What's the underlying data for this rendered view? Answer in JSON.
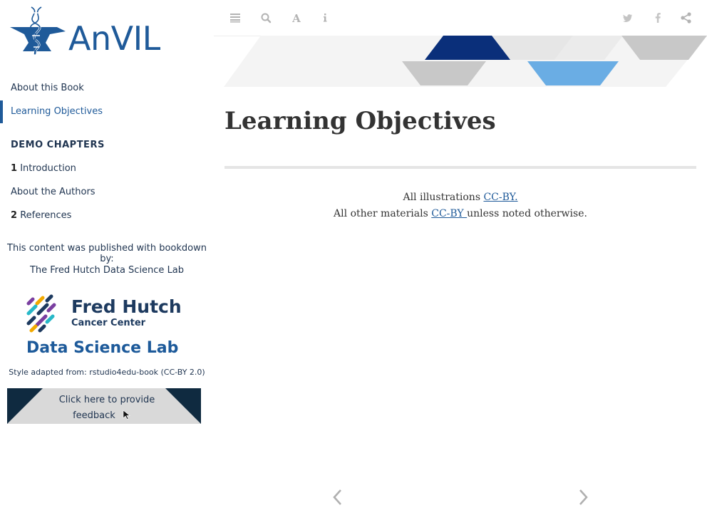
{
  "brand": {
    "name": "AnVIL"
  },
  "sidebar": {
    "items": [
      {
        "label": "About this Book",
        "number": ""
      },
      {
        "label": "Learning Objectives",
        "number": ""
      },
      {
        "label": "Introduction",
        "number": "1"
      },
      {
        "label": "About the Authors",
        "number": ""
      },
      {
        "label": "References",
        "number": "2"
      }
    ],
    "section_header": "DEMO CHAPTERS",
    "published_by": "This content was published with bookdown by:",
    "publisher": "The Fred Hutch Data Science Lab",
    "fred_hutch": {
      "name": "Fred Hutch",
      "sub": "Cancer Center",
      "lab": "Data Science Lab"
    },
    "style_note": "Style adapted from: rstudio4edu-book (CC-BY 2.0)",
    "feedback": {
      "line1": "Click here to provide",
      "line2": "feedback"
    }
  },
  "toolbar": {
    "icons": [
      "menu-icon",
      "search-icon",
      "font-icon",
      "info-icon",
      "twitter-icon",
      "facebook-icon",
      "share-icon"
    ]
  },
  "main": {
    "title": "Learning Objectives",
    "license": {
      "line1_prefix": "All illustrations ",
      "line1_link": "CC-BY.",
      "line2_prefix": "All other materials ",
      "line2_link": "CC-BY ",
      "line2_suffix": "unless noted otherwise."
    }
  },
  "colors": {
    "accent": "#1f5a99",
    "navy": "#0f2a40",
    "banner_blue": "#6aade4",
    "banner_navy": "#0a2f7a"
  }
}
